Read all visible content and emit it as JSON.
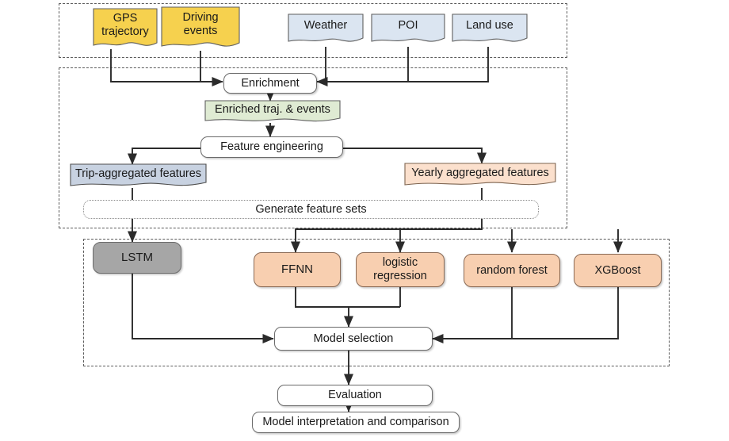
{
  "diagram": {
    "title": "Driving behaviour modelling pipeline flowchart",
    "colors": {
      "yellow": "#f6d14e",
      "light_blue": "#dbe5f1",
      "green": "#dfebd3",
      "blue_gray": "#c8d2e1",
      "peach": "#fbe0cd",
      "orange": "#f8cfb0",
      "gray": "#a6a6a6",
      "white": "#ffffff",
      "stroke": "#6b6b6b",
      "dashed_group": "#5c5c5c"
    },
    "groups": [
      {
        "name": "data-sources-group",
        "label": ""
      },
      {
        "name": "feature-pipeline-group",
        "label": ""
      },
      {
        "name": "modelling-group",
        "label": ""
      }
    ],
    "nodes": {
      "gps_trajectory": "GPS\ntrajectory",
      "gps_trajectory_line1": "GPS",
      "gps_trajectory_line2": "trajectory",
      "driving_events_line1": "Driving",
      "driving_events_line2": "events",
      "weather": "Weather",
      "poi": "POI",
      "land_use": "Land use",
      "enrichment": "Enrichment",
      "enriched_traj_events": "Enriched traj. & events",
      "feature_engineering": "Feature engineering",
      "trip_aggregated_features": "Trip-aggregated features",
      "yearly_aggregated_features": "Yearly aggregated features",
      "generate_feature_sets": "Generate feature sets",
      "lstm": "LSTM",
      "ffnn": "FFNN",
      "logistic_regression_line1": "logistic",
      "logistic_regression_line2": "regression",
      "random_forest": "random forest",
      "xgboost": "XGBoost",
      "model_selection": "Model selection",
      "evaluation": "Evaluation",
      "model_interpretation": "Model interpretation and comparison"
    }
  }
}
